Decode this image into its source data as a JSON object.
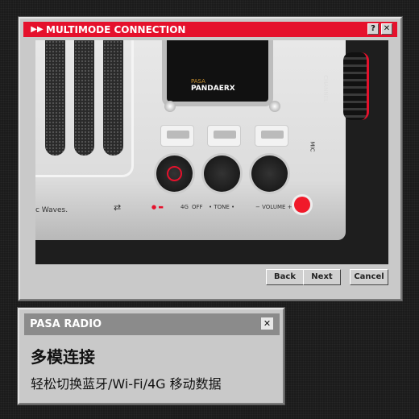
{
  "main_window": {
    "title": "MULTIMODE CONNECTION",
    "help_label": "?",
    "close_label": "✕",
    "title_icon": "fast-forward-icon",
    "accent": "#e5112c",
    "product": {
      "brand": "PASA",
      "model": "PANDAERX",
      "tagline_fragment": "c Waves.",
      "channel_label": "CHANNEL",
      "mic_label": "MIC",
      "mode_labels": [
        "4G",
        "OFF"
      ],
      "tone_label": "• TONE •",
      "volume_label": "− VOLUME +"
    },
    "buttons": {
      "back": "Back",
      "next": "Next",
      "cancel": "Cancel"
    }
  },
  "info_window": {
    "title": "PASA RADIO",
    "close_label": "✕",
    "heading": "多模连接",
    "subtitle": "轻松切换蓝牙/Wi-Fi/4G 移动数据"
  }
}
